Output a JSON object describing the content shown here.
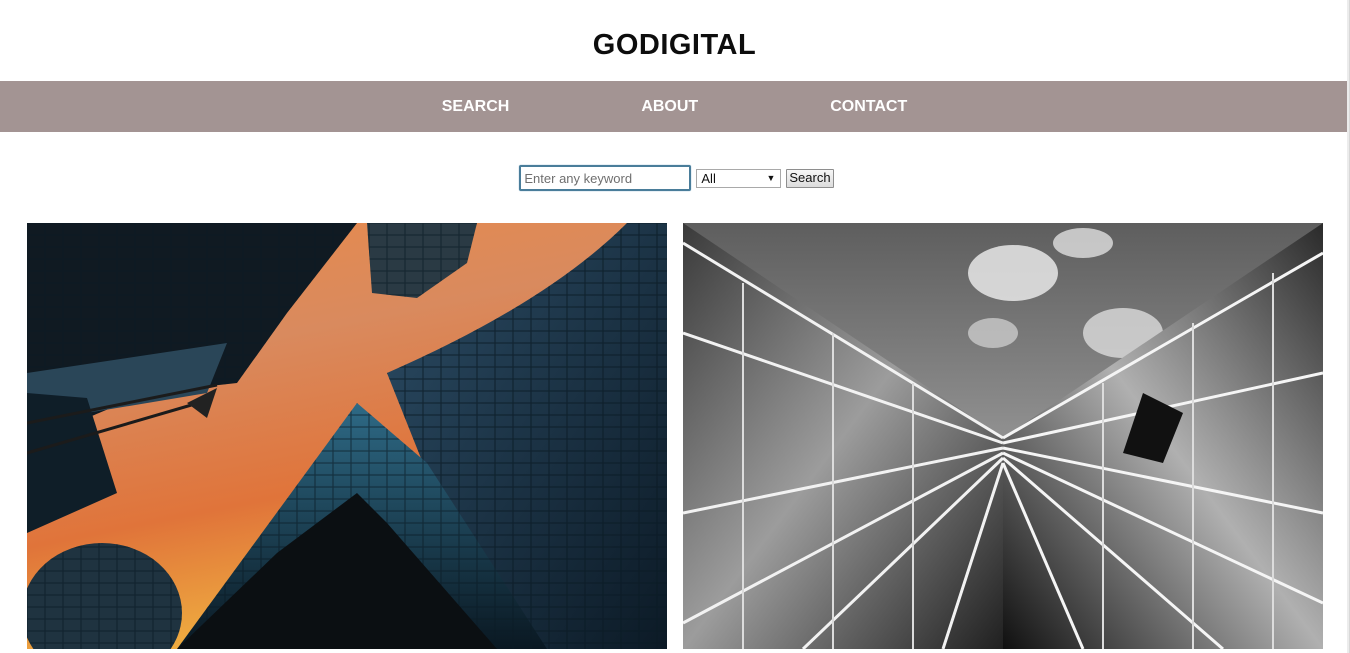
{
  "site": {
    "title": "GODIGITAL"
  },
  "nav": {
    "items": [
      {
        "label": "SEARCH"
      },
      {
        "label": "ABOUT"
      },
      {
        "label": "CONTACT"
      }
    ]
  },
  "search": {
    "placeholder": "Enter any keyword",
    "value": "",
    "category_selected": "All",
    "button_label": "Search"
  },
  "gallery": {
    "photos": [
      {
        "subject": "skyscrapers-sunset-color"
      },
      {
        "subject": "glass-building-black-white"
      }
    ]
  },
  "colors": {
    "nav_background": "#a39493",
    "nav_text": "#ffffff",
    "title_text": "#0d0d0d",
    "input_focus_border": "#4a7d9a"
  }
}
